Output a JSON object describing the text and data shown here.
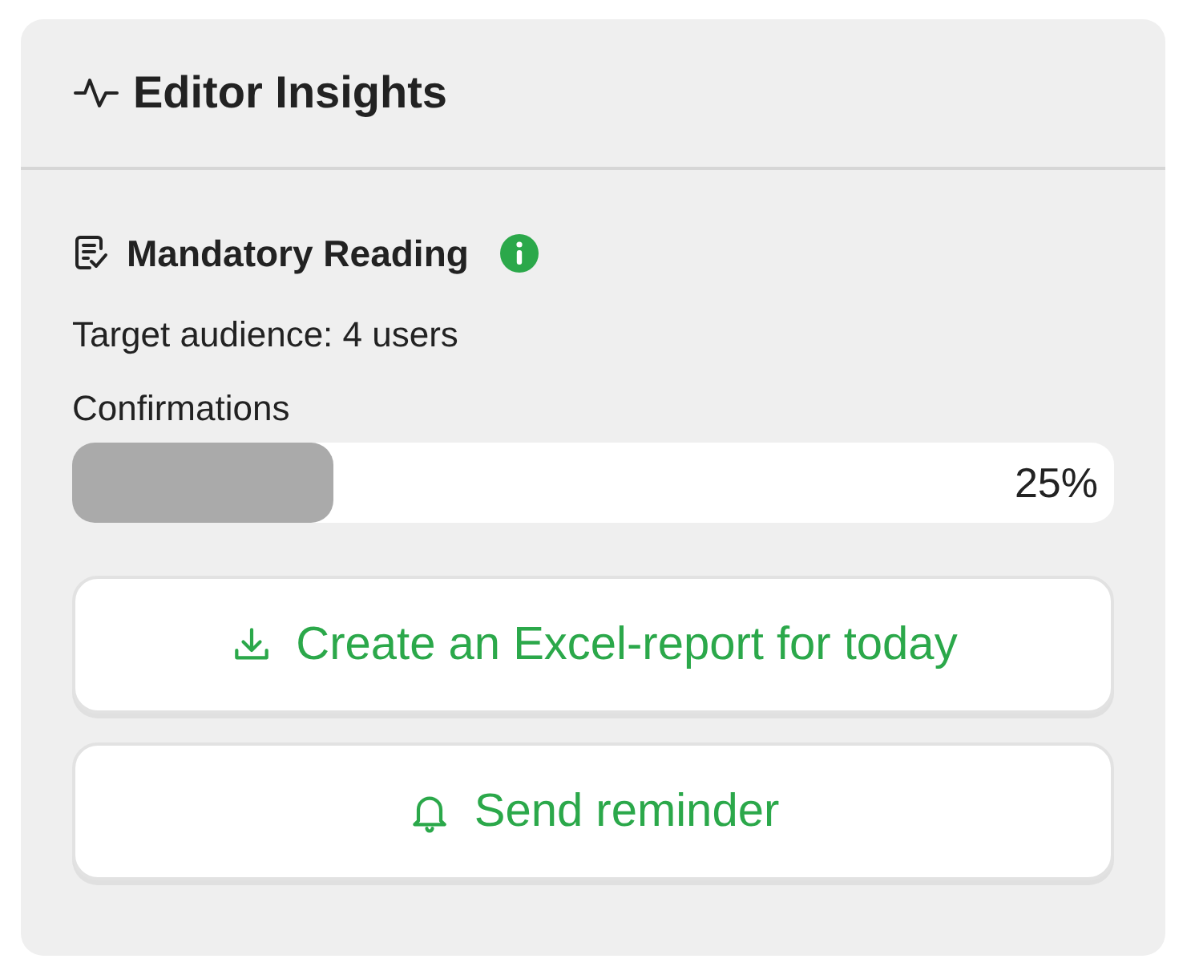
{
  "panel": {
    "title": "Editor Insights"
  },
  "section": {
    "title": "Mandatory Reading",
    "audience": "Target audience: 4 users",
    "progress_label": "Confirmations",
    "level": 0.25,
    "reading": "25%"
  },
  "buttons": [
    {
      "kind": "download",
      "label": "Create an Excel-report for today"
    },
    {
      "kind": "bell",
      "label": "Send reminder"
    }
  ]
}
